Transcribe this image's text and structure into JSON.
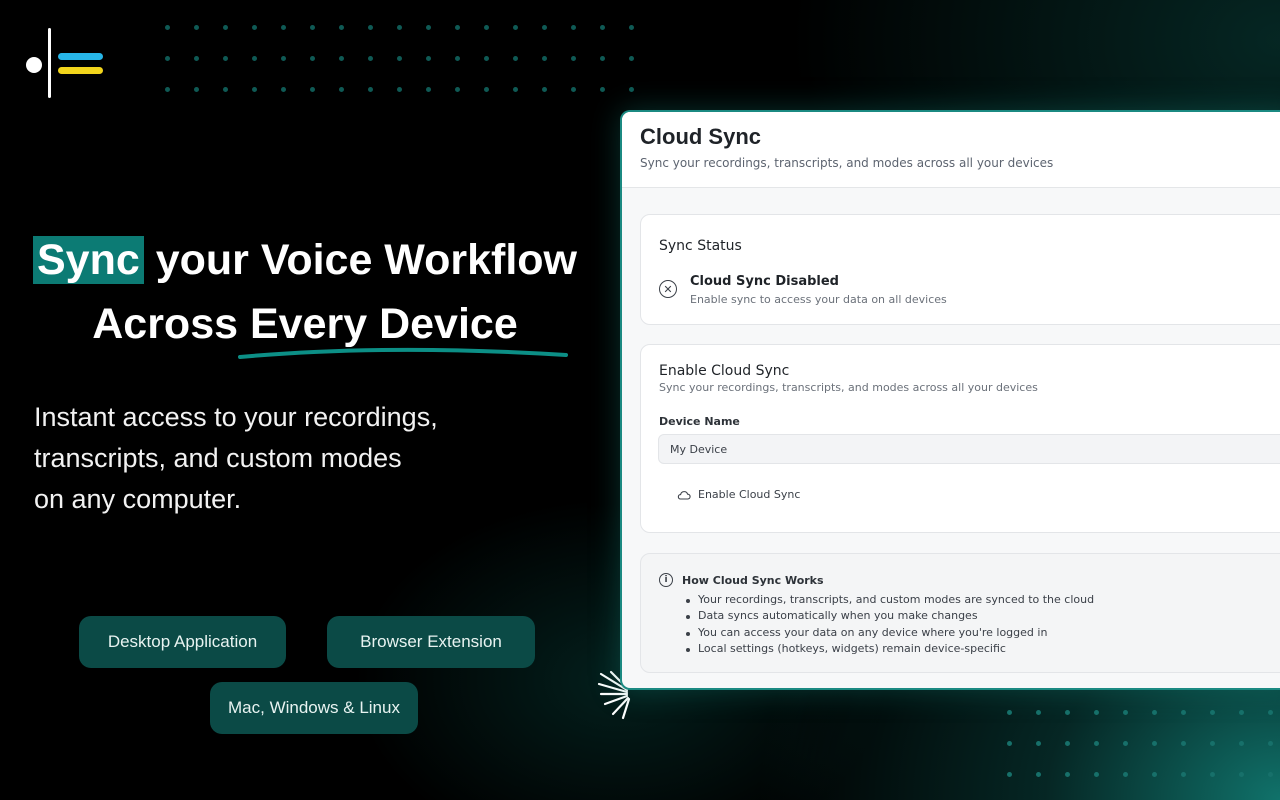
{
  "headline": {
    "highlight": "Sync",
    "line1_rest": " your Voice Workflow",
    "line2": "Across Every Device"
  },
  "subtext": {
    "line1": "Instant access to your recordings,",
    "line2": "transcripts, and custom modes",
    "line3": "on any computer."
  },
  "pills": [
    "Desktop Application",
    "Browser Extension",
    "Mac, Windows & Linux"
  ],
  "colors": {
    "accent": "#0c7b74",
    "pill_bg": "#0b4a46",
    "logo_blue": "#27b6e8",
    "logo_yellow": "#f2d51c"
  },
  "app": {
    "title": "Cloud Sync",
    "subtitle": "Sync your recordings, transcripts, and modes across all your devices",
    "status_card": {
      "heading": "Sync Status",
      "icon": "x-circle-icon",
      "state_title": "Cloud Sync Disabled",
      "state_subtitle": "Enable sync to access your data on all devices"
    },
    "enable_card": {
      "heading": "Enable Cloud Sync",
      "subtitle": "Sync your recordings, transcripts, and modes across all your devices",
      "field_label": "Device Name",
      "field_value": "My Device",
      "button_label": "Enable Cloud Sync",
      "button_icon": "cloud-icon"
    },
    "info_card": {
      "icon": "info-icon",
      "title": "How Cloud Sync Works",
      "items": [
        "Your recordings, transcripts, and custom modes are synced to the cloud",
        "Data syncs automatically when you make changes",
        "You can access your data on any device where you're logged in",
        "Local settings (hotkeys, widgets) remain device-specific"
      ]
    }
  }
}
